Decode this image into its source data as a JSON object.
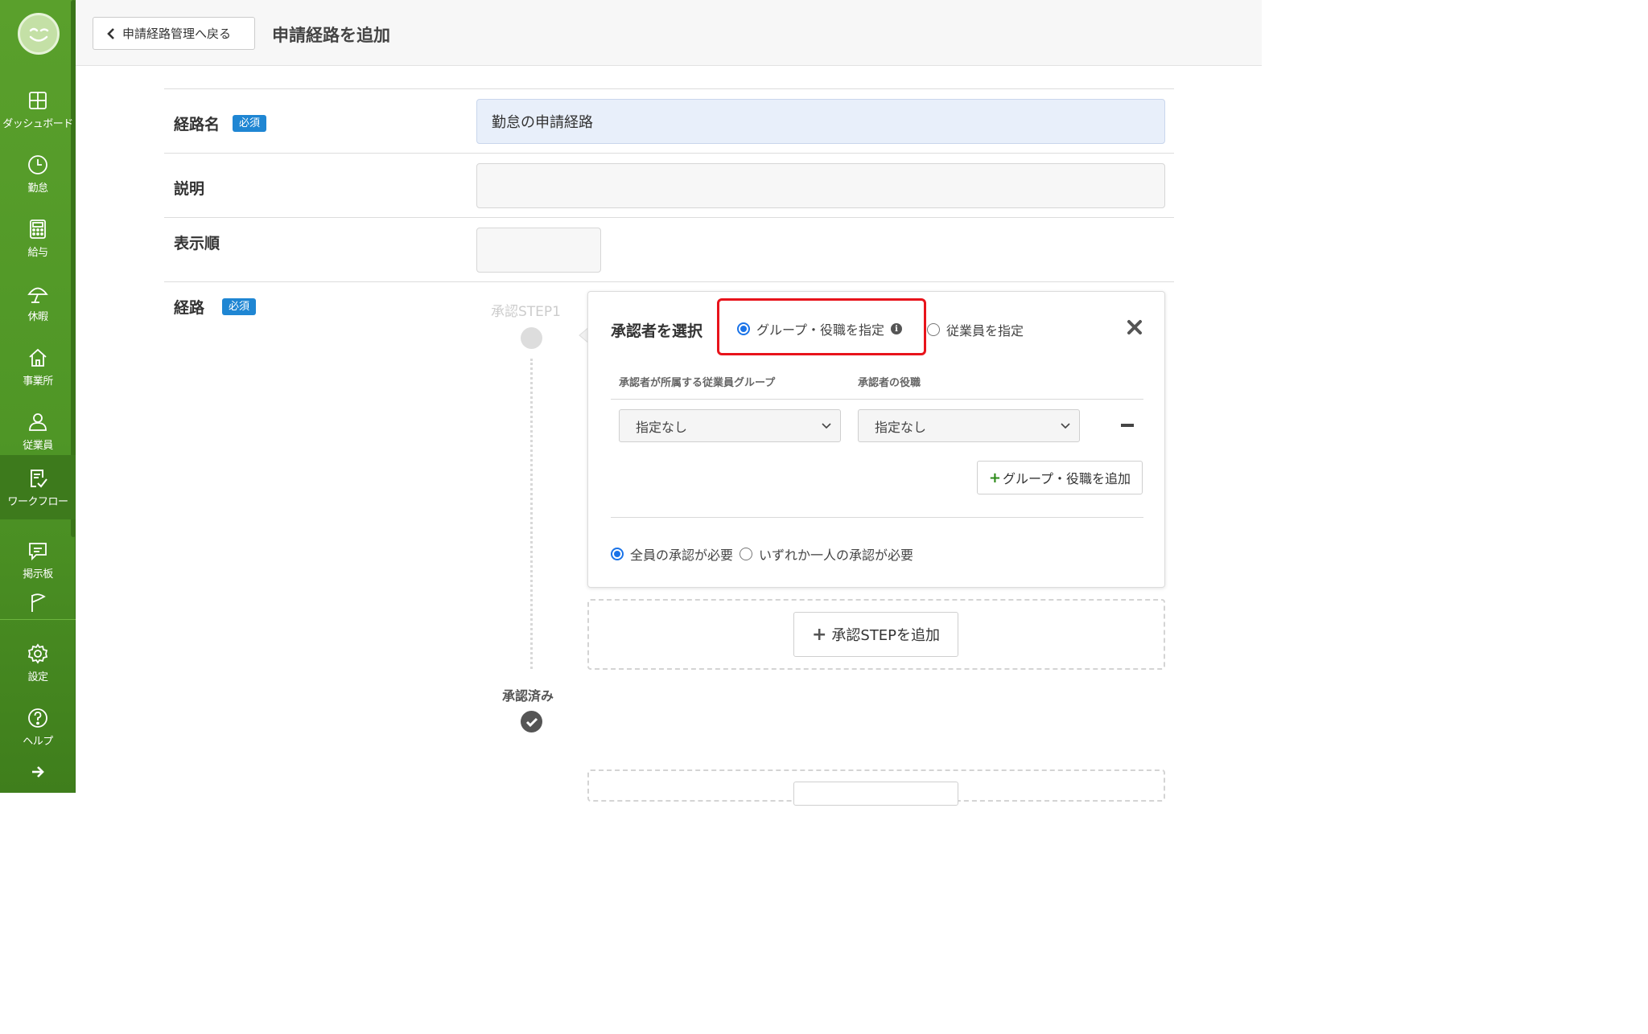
{
  "sidebar": {
    "items": [
      {
        "label": "ダッシュボード",
        "icon": "dashboard-icon"
      },
      {
        "label": "勤怠",
        "icon": "clock-icon"
      },
      {
        "label": "給与",
        "icon": "calculator-icon"
      },
      {
        "label": "休暇",
        "icon": "umbrella-icon"
      },
      {
        "label": "事業所",
        "icon": "home-icon"
      },
      {
        "label": "従業員",
        "icon": "person-icon"
      },
      {
        "label": "ワークフロー",
        "icon": "workflow-icon"
      },
      {
        "label": "掲示板",
        "icon": "chat-icon"
      },
      {
        "label": "",
        "icon": "flag-icon"
      },
      {
        "label": "設定",
        "icon": "gear-icon"
      },
      {
        "label": "ヘルプ",
        "icon": "help-icon"
      }
    ],
    "active_item": "ワークフロー",
    "colors": {
      "bg": "#4f9626",
      "active": "#3d7a1c"
    }
  },
  "header": {
    "back_label": "申請経路管理へ戻る",
    "title": "申請経路を追加"
  },
  "form": {
    "required_badge": "必須",
    "route_name": {
      "label": "経路名",
      "value": "勤怠の申請経路"
    },
    "description": {
      "label": "説明",
      "value": ""
    },
    "display_order": {
      "label": "表示順",
      "value": ""
    },
    "route": {
      "label": "経路"
    }
  },
  "timeline": {
    "step_label": "承認STEP1",
    "approved_label": "承認済み"
  },
  "approver_card": {
    "title": "承認者を選択",
    "option_group_role": "グループ・役職を指定",
    "option_employee": "従業員を指定",
    "selected_option": "グループ・役職を指定",
    "col_group": "承認者が所属する従業員グループ",
    "col_role": "承認者の役職",
    "group_select_value": "指定なし",
    "role_select_value": "指定なし",
    "add_group_label": "グループ・役職を追加",
    "approval_all": "全員の承認が必要",
    "approval_any": "いずれか一人の承認が必要",
    "selected_approval": "全員の承認が必要",
    "highlight_color": "#e8131b"
  },
  "add_step_label": "承認STEPを追加"
}
